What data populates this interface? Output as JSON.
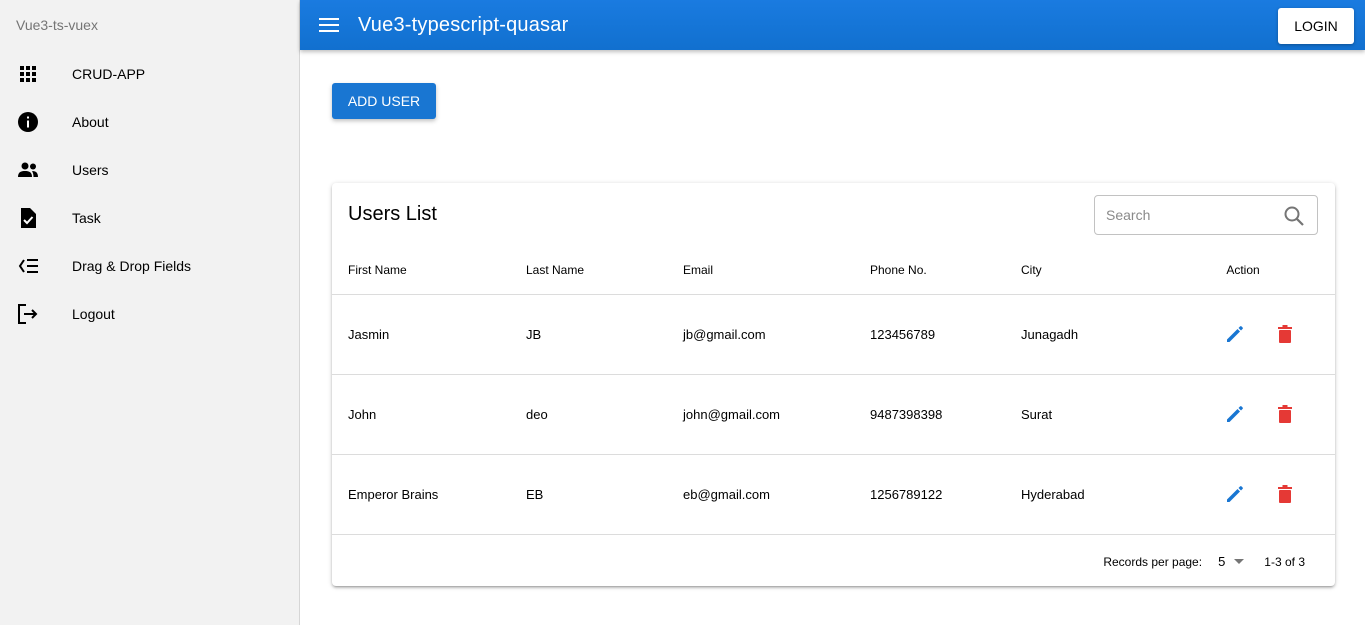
{
  "drawer": {
    "title": "Vue3-ts-vuex",
    "items": [
      {
        "label": "CRUD-APP",
        "icon": "apps-grid-icon"
      },
      {
        "label": "About",
        "icon": "info-icon"
      },
      {
        "label": "Users",
        "icon": "people-icon"
      },
      {
        "label": "Task",
        "icon": "task-check-icon"
      },
      {
        "label": "Drag & Drop Fields",
        "icon": "checklist-icon"
      },
      {
        "label": "Logout",
        "icon": "logout-icon"
      }
    ]
  },
  "header": {
    "title": "Vue3-typescript-quasar",
    "login_label": "LOGIN",
    "color": "#1976d2"
  },
  "toolbar": {
    "add_user_label": "ADD USER"
  },
  "users_card": {
    "title": "Users List",
    "search_placeholder": "Search",
    "columns": [
      "First Name",
      "Last Name",
      "Email",
      "Phone No.",
      "City",
      "Action"
    ],
    "rows": [
      {
        "first_name": "Jasmin",
        "last_name": "JB",
        "email": "jb@gmail.com",
        "phone": "123456789",
        "city": "Junagadh"
      },
      {
        "first_name": "John",
        "last_name": "deo",
        "email": "john@gmail.com",
        "phone": "9487398398",
        "city": "Surat"
      },
      {
        "first_name": "Emperor Brains",
        "last_name": "EB",
        "email": "eb@gmail.com",
        "phone": "1256789122",
        "city": "Hyderabad"
      }
    ],
    "pagination": {
      "records_per_page_label": "Records per page:",
      "records_per_page": "5",
      "page_info": "1-3 of 3"
    },
    "edit_color": "#1976d2",
    "delete_color": "#e53935"
  }
}
